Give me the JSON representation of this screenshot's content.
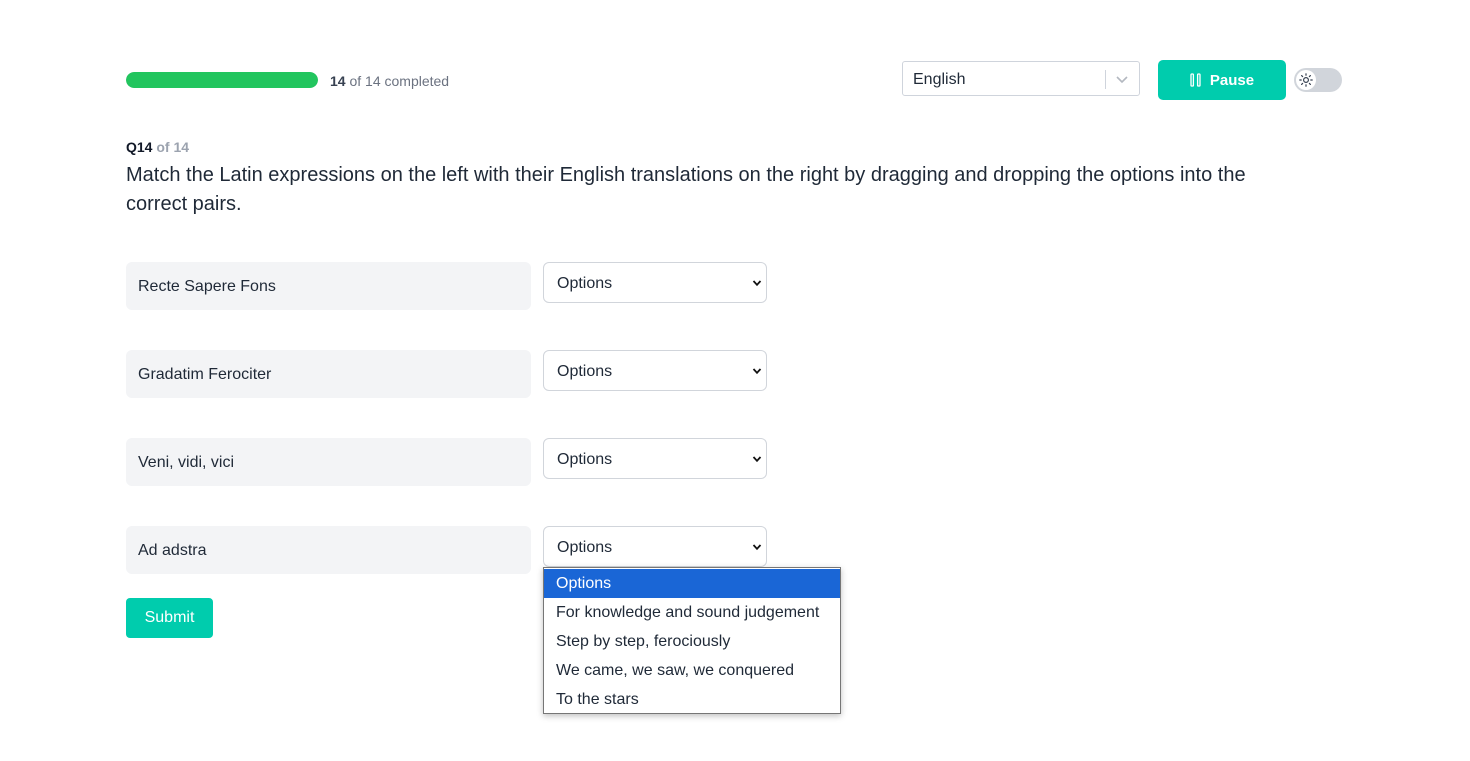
{
  "progress": {
    "done": "14",
    "rest": " of 14 completed",
    "fraction": 1.0
  },
  "language": {
    "selected": "English"
  },
  "controls": {
    "pause_label": "Pause"
  },
  "question": {
    "number": "Q14",
    "of_total": " of 14",
    "text": "Match the Latin expressions on the left with their English translations on the right by dragging and dropping the options into the correct pairs."
  },
  "pairs": [
    {
      "term": "Recte Sapere Fons",
      "selected": "Options"
    },
    {
      "term": "Gradatim Ferociter",
      "selected": "Options"
    },
    {
      "term": "Veni, vidi, vici",
      "selected": "Options"
    },
    {
      "term": "Ad adstra",
      "selected": "Options"
    }
  ],
  "dropdown_options": [
    "Options",
    "For knowledge and sound judgement",
    "Step by step, ferociously",
    "We came, we saw, we conquered",
    "To the stars"
  ],
  "submit_label": "Submit",
  "colors": {
    "accent": "#00ccad",
    "progress": "#22c55e",
    "highlight": "#1a66d6"
  }
}
